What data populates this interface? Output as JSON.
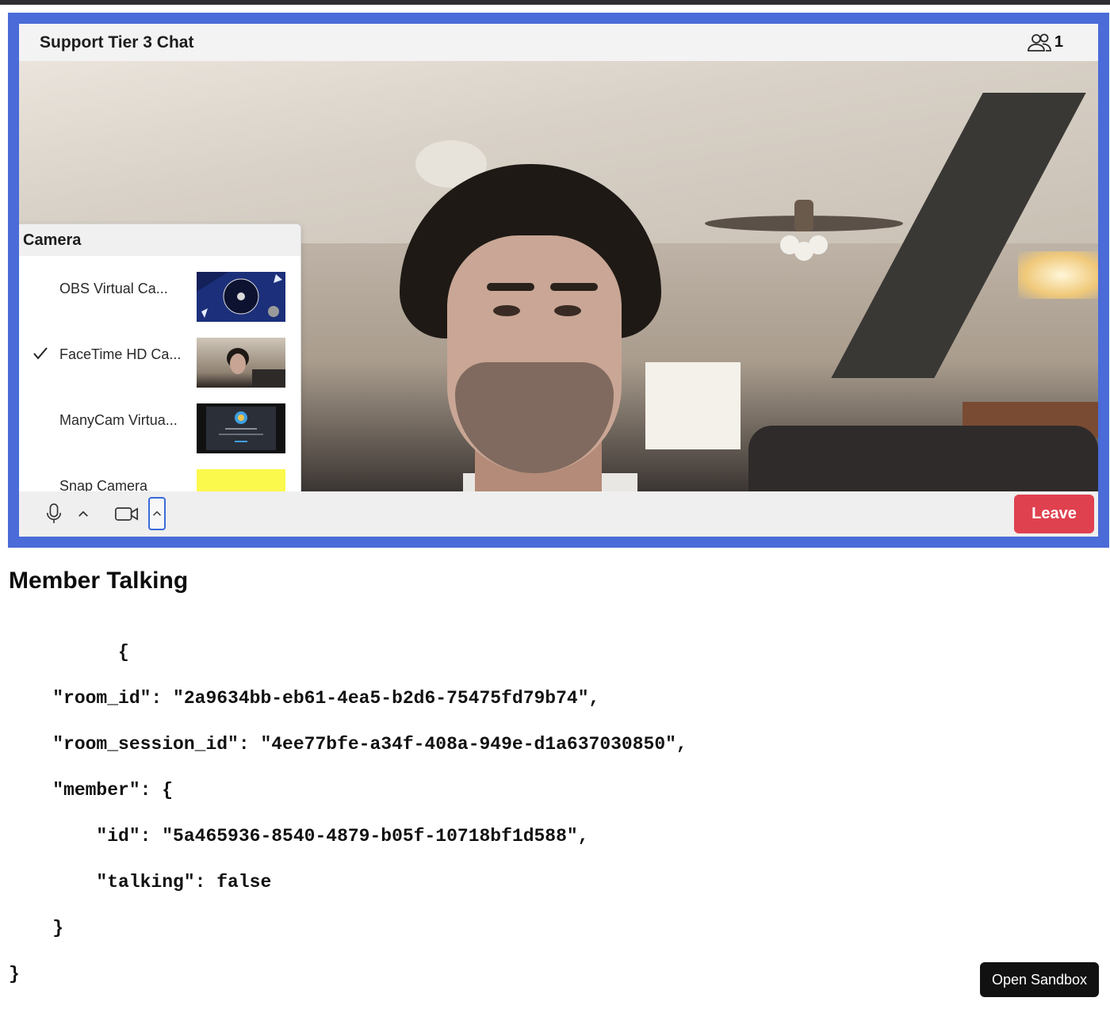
{
  "room": {
    "title": "Support Tier 3 Chat",
    "participant_count": "1"
  },
  "camera_menu": {
    "heading": "Camera",
    "items": [
      {
        "label": "OBS Virtual Ca...",
        "selected": false,
        "thumb": "obs"
      },
      {
        "label": "FaceTime HD Ca...",
        "selected": true,
        "thumb": "facetime"
      },
      {
        "label": "ManyCam Virtua...",
        "selected": false,
        "thumb": "manycam"
      },
      {
        "label": "Snap Camera",
        "selected": false,
        "thumb": "snap"
      }
    ]
  },
  "controls": {
    "leave_label": "Leave",
    "icons": [
      "microphone-icon",
      "chevron-up-icon",
      "video-camera-icon",
      "chevron-up-icon"
    ]
  },
  "section": {
    "title": "Member Talking"
  },
  "event_json": {
    "lines": [
      "          {",
      "    \"room_id\": \"2a9634bb-eb61-4ea5-b2d6-75475fd79b74\",",
      "    \"room_session_id\": \"4ee77bfe-a34f-408a-949e-d1a637030850\",",
      "    \"member\": {",
      "        \"id\": \"5a465936-8540-4879-b05f-10718bf1d588\",",
      "        \"talking\": false",
      "    }",
      "}"
    ]
  },
  "sandbox": {
    "label": "Open Sandbox"
  },
  "colors": {
    "frame_border": "#4a6bd8",
    "leave_button": "#e0414f",
    "active_control_outline": "#3b6ad9"
  }
}
